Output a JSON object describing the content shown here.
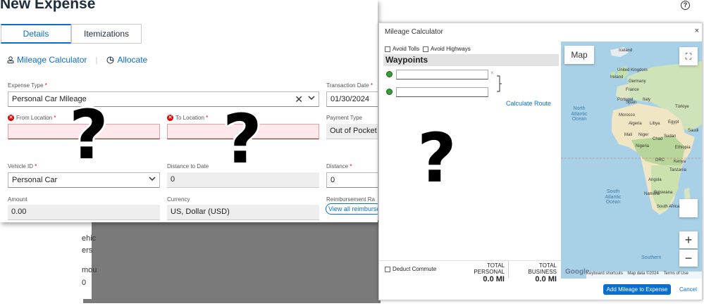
{
  "page": {
    "title": "New Expense",
    "question_mark": "?"
  },
  "tabs": [
    {
      "label": "Details"
    },
    {
      "label": "Itemizations"
    }
  ],
  "actions": {
    "mileage": "Mileage Calculator",
    "allocate": "Allocate"
  },
  "form": {
    "expense_type": {
      "label": "Expense Type",
      "value": "Personal Car Mileage"
    },
    "transaction_date": {
      "label": "Transaction Date",
      "value": "01/30/2024"
    },
    "from_location": {
      "label": "From Location",
      "value": ""
    },
    "to_location": {
      "label": "To Location",
      "value": ""
    },
    "payment_type": {
      "label": "Payment Type",
      "value": "Out of Pocket"
    },
    "vehicle_id": {
      "label": "Vehicle ID",
      "value": "Personal Car"
    },
    "distance_to_date": {
      "label": "Distance to Date",
      "value": "0"
    },
    "distance": {
      "label": "Distance",
      "value": "0"
    },
    "amount": {
      "label": "Amount",
      "value": "0.00"
    },
    "currency": {
      "label": "Currency",
      "value": "US, Dollar (USD)"
    },
    "reimbursement_rate": {
      "label": "Reimbursement Ra",
      "link": "View all reimburse"
    }
  },
  "background_fragments": [
    "ehic",
    "ers",
    "mou",
    "0"
  ],
  "help": "?",
  "mileage_calc": {
    "title": "Mileage Calculator",
    "close": "×",
    "avoid_tolls": "Avoid Tolls",
    "avoid_highways": "Avoid Highways",
    "waypoints": "Waypoints",
    "remove": "×",
    "calculate_route": "Calculate Route",
    "deduct_commute": "Deduct Commute",
    "total_personal_label": "TOTAL PERSONAL",
    "total_personal_value": "0.0 MI",
    "total_business_label": "TOTAL BUSINESS",
    "total_business_value": "0.0 MI",
    "add_button": "Add Mileage to Expense",
    "cancel": "Cancel"
  },
  "map": {
    "type_button": "Map",
    "fullscreen": "⛶",
    "zoom_in": "+",
    "zoom_out": "−",
    "google": "Google",
    "keyboard_shortcuts": "Keyboard shortcuts",
    "map_data": "Map data ©2024",
    "terms": "Terms of Use",
    "labels": {
      "iceland": "Iceland",
      "united_kingdom": "United Kingdom",
      "ireland": "Ireland",
      "france": "France",
      "spain": "Spain",
      "portugal": "Portugal",
      "germany": "Germany",
      "italy": "Italy",
      "turkiye": "Türkiye",
      "morocco": "Morocco",
      "algeria": "Algeria",
      "libya": "Libya",
      "egypt": "Egypt",
      "saudi": "Saudi",
      "mali": "Mali",
      "niger": "Niger",
      "chad": "Chad",
      "sudan": "Sudan",
      "nigeria": "Nigeria",
      "ethiopia": "Ethiopia",
      "drc": "DRC",
      "kenya": "Kenya",
      "tanzania": "Tanzania",
      "angola": "Angola",
      "namibia": "Namibia",
      "botswana": "Botswana",
      "south_africa": "South Africa",
      "north_atlantic": "North Atlantic Ocean",
      "south_atlantic": "South Atlantic Ocean",
      "southern": "Southern"
    }
  }
}
